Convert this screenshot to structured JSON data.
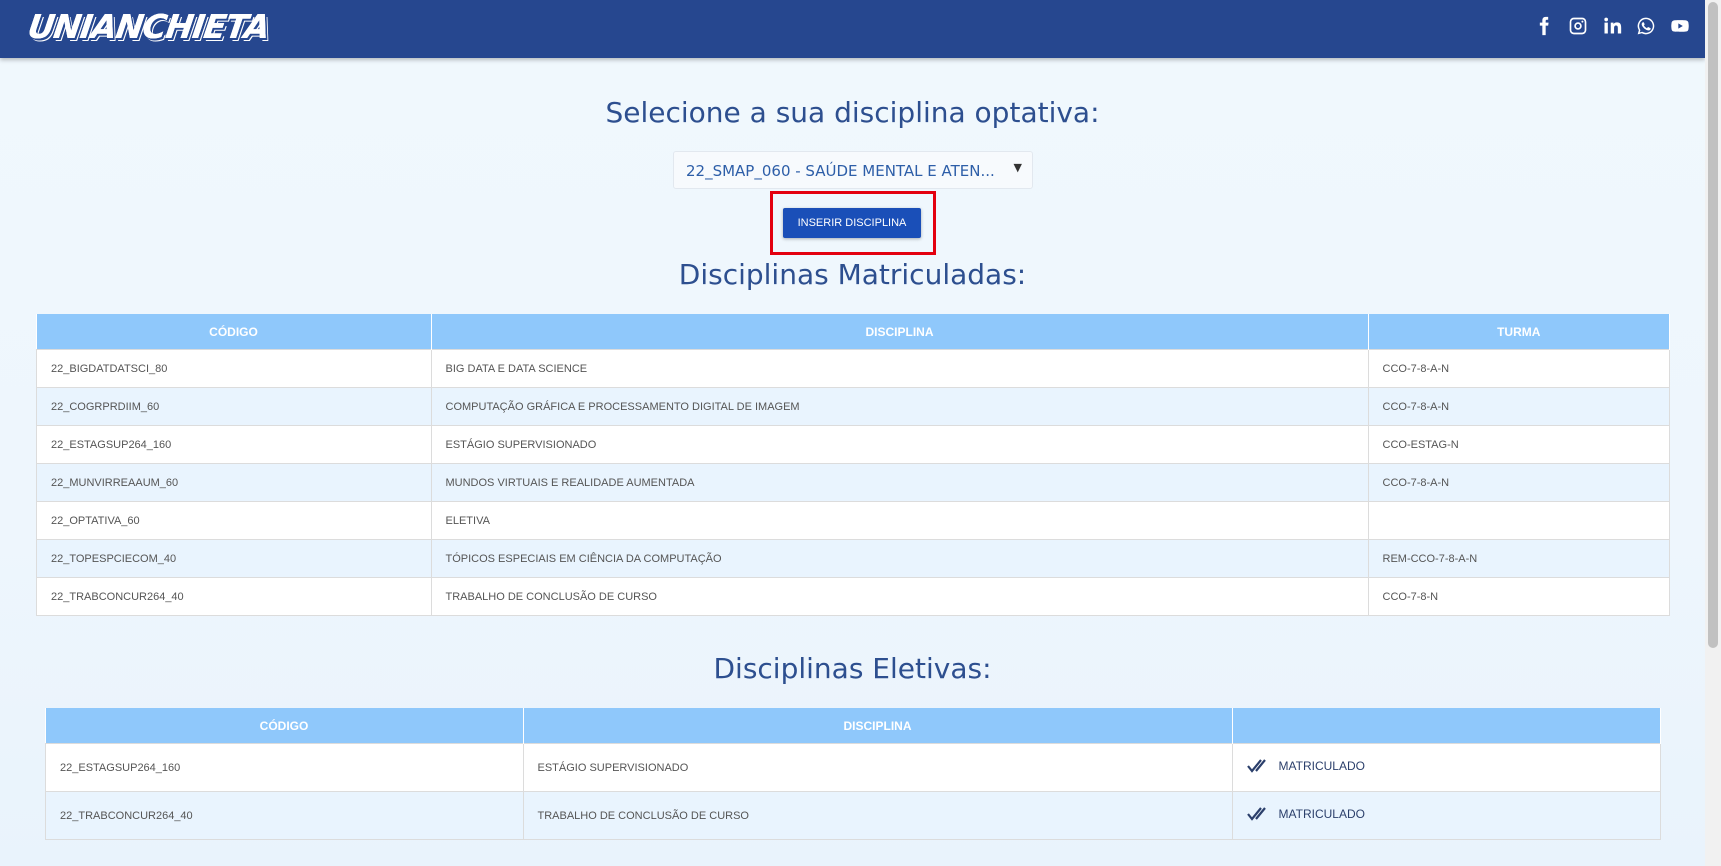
{
  "header": {
    "logo_text": "UNIANCHIETA",
    "social_icons": [
      "facebook-icon",
      "instagram-icon",
      "linkedin-icon",
      "whatsapp-icon",
      "youtube-icon"
    ]
  },
  "main": {
    "select_title": "Selecione a sua disciplina optativa:",
    "select_value": "22_SMAP_060 - SAÚDE MENTAL E ATEN...",
    "insert_button": "INSERIR DISCIPLINA"
  },
  "enrolled": {
    "title": "Disciplinas Matriculadas:",
    "headers": [
      "CÓDIGO",
      "DISCIPLINA",
      "TURMA"
    ],
    "rows": [
      [
        "22_BIGDATDATSCI_80",
        "BIG DATA E DATA SCIENCE",
        "CCO-7-8-A-N"
      ],
      [
        "22_COGRPRDIIM_60",
        "COMPUTAÇÃO GRÁFICA E PROCESSAMENTO DIGITAL DE IMAGEM",
        "CCO-7-8-A-N"
      ],
      [
        "22_ESTAGSUP264_160",
        "ESTÁGIO SUPERVISIONADO",
        "CCO-ESTAG-N"
      ],
      [
        "22_MUNVIRREAAUM_60",
        "MUNDOS VIRTUAIS E REALIDADE AUMENTADA",
        "CCO-7-8-A-N"
      ],
      [
        "22_OPTATIVA_60",
        "ELETIVA",
        ""
      ],
      [
        "22_TOPESPCIECOM_40",
        "TÓPICOS ESPECIAIS EM CIÊNCIA DA COMPUTAÇÃO",
        "REM-CCO-7-8-A-N"
      ],
      [
        "22_TRABCONCUR264_40",
        "TRABALHO DE CONCLUSÃO DE CURSO",
        "CCO-7-8-N"
      ]
    ]
  },
  "electives": {
    "title": "Disciplinas Eletivas:",
    "headers": [
      "CÓDIGO",
      "DISCIPLINA",
      ""
    ],
    "rows": [
      [
        "22_ESTAGSUP264_160",
        "ESTÁGIO SUPERVISIONADO",
        "MATRICULADO"
      ],
      [
        "22_TRABCONCUR264_40",
        "TRABALHO DE CONCLUSÃO DE CURSO",
        "MATRICULADO"
      ]
    ]
  },
  "colors": {
    "header_bg": "#26478f",
    "table_header": "#8fc8fb",
    "button": "#1a4fb8",
    "highlight": "#e3000f"
  }
}
